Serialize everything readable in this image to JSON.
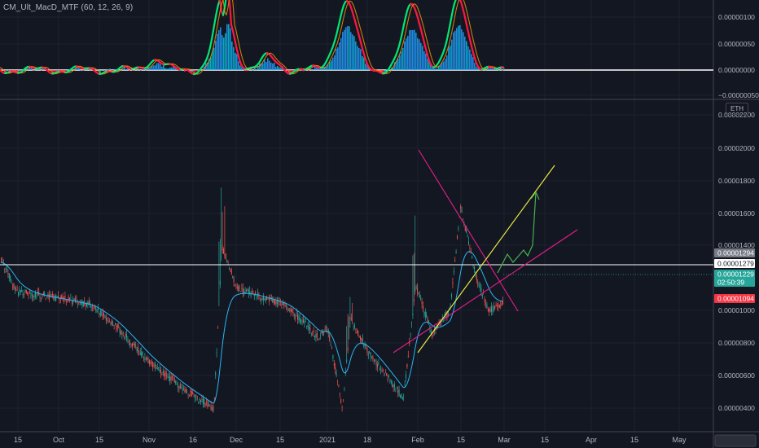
{
  "indicator": {
    "title": "CM_Ult_MacD_MTF (60, 12, 26, 9)",
    "axis_labels": [
      "0.00000100",
      "0.00000050",
      "0.00000000",
      "−0.00000050"
    ]
  },
  "price_axis": {
    "currency": "ETH",
    "labels": [
      "0.00002200",
      "0.00002000",
      "0.00001800",
      "0.00001600",
      "0.00001400",
      "0.00001000",
      "0.00000800",
      "0.00000600",
      "0.00000400"
    ],
    "tags": [
      {
        "text": "0.00001294",
        "bg": "#787b86",
        "fg": "#ffffff"
      },
      {
        "text": "0.00001279",
        "bg": "#ffffff",
        "fg": "#131722"
      },
      {
        "text": "0.00001229",
        "bg": "#26a69a",
        "fg": "#ffffff"
      },
      {
        "text": "02:50:39",
        "bg": "#26a69a",
        "fg": "#ffffff"
      },
      {
        "text": "0.00001094",
        "bg": "#f23645",
        "fg": "#ffffff"
      }
    ]
  },
  "time_axis": {
    "labels": [
      "15",
      "Oct",
      "15",
      "Nov",
      "16",
      "Dec",
      "15",
      "2021",
      "18",
      "Feb",
      "15",
      "Mar",
      "15",
      "Apr",
      "15",
      "May"
    ]
  },
  "chart_data": [
    {
      "type": "line",
      "title": "CM_Ult_MacD_MTF (60, 12, 26, 9)",
      "ylim": [
        -6e-07,
        1.2e-06
      ],
      "series": [
        {
          "values_x": [
            "Sep 14",
            "Oct 1",
            "Nov 1",
            "Nov 28",
            "Dec 1",
            "Jan 1",
            "Jan 5",
            "Jan 15",
            "Jan 28",
            "Feb 1",
            "Feb 8",
            "Feb 15",
            "Feb 20",
            "Mar 1"
          ],
          "values": [
            1e-08,
            3e-08,
            -5e-08,
            1.18e-06,
            1e-07,
            -3e-08,
            8e-07,
            -4e-08,
            8e-07,
            6e-07,
            -5e-08,
            7e-07,
            -3e-08,
            2e-08
          ]
        }
      ],
      "colors": {
        "up": "#00e676",
        "down": "#ff1744",
        "hist": "#2196f3",
        "zero_line": "#ffffff"
      }
    },
    {
      "type": "line",
      "title": "",
      "xlabel": "",
      "ylabel": "",
      "currency": "ETH",
      "ylim": [
        3.2e-06,
        2.3e-06
      ],
      "price_line": 1.279e-05,
      "last_price": 1.229e-05,
      "series": [
        {
          "x": [
            "Sep 14",
            "Sep 20",
            "Oct 1",
            "Oct 15",
            "Oct 25",
            "Nov 5",
            "Nov 15",
            "Nov 25",
            "Nov 27",
            "Dec 1",
            "Dec 15",
            "Dec 25",
            "Jan 1",
            "Jan 5",
            "Jan 10",
            "Jan 18",
            "Jan 25",
            "Jan 30",
            "Feb 5",
            "Feb 12",
            "Feb 15",
            "Feb 20",
            "Feb 25",
            "Mar 1"
          ],
          "values": [
            1.36e-05,
            1.26e-05,
            1.24e-05,
            1.22e-05,
            1.16e-05,
            1.05e-05,
            9.7e-06,
            9e-06,
            1.4e-05,
            1.27e-05,
            1.22e-05,
            1.12e-05,
            1.15e-05,
            9e-06,
            1.18e-05,
            1.08e-05,
            9.3e-06,
            1.28e-05,
            1.13e-05,
            1.2e-05,
            1.52e-05,
            1.3e-05,
            1.2e-05,
            1.23e-05
          ]
        }
      ],
      "annotations": {
        "trend_lines": [
          "magenta",
          "magenta",
          "yellow"
        ],
        "projection_color": "#4caf50",
        "projection_target_date": "Mar 12",
        "projection_target_price": 1.72e-05
      }
    }
  ]
}
